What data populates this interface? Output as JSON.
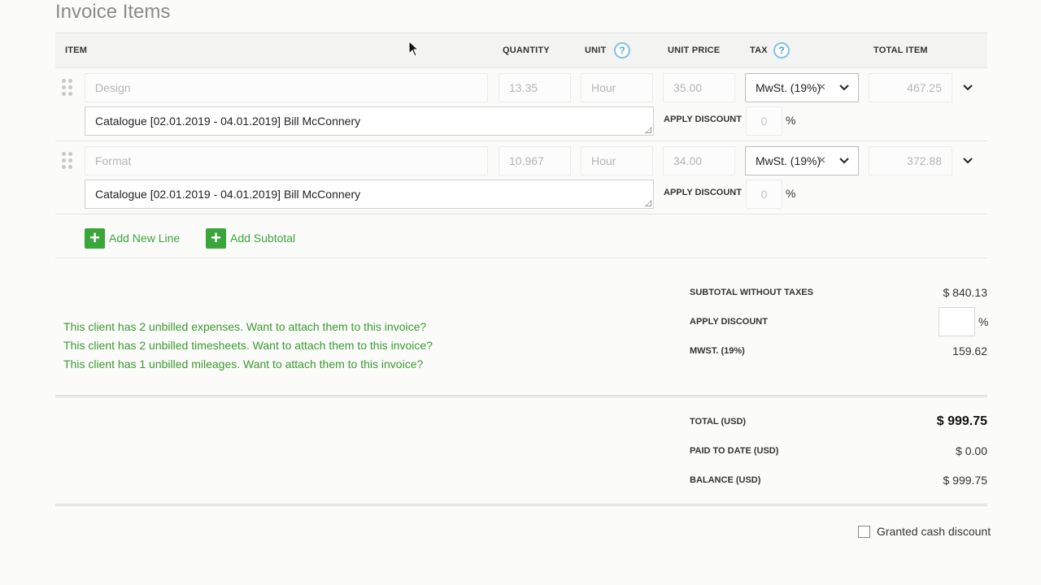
{
  "page": {
    "title": "Invoice Items"
  },
  "table": {
    "headers": {
      "item": "ITEM",
      "quantity": "QUANTITY",
      "unit": "UNIT",
      "unit_price": "UNIT PRICE",
      "tax": "TAX",
      "total_item": "TOTAL ITEM"
    },
    "help_glyph": "?",
    "rows": [
      {
        "item": "Design",
        "quantity": "13.35",
        "unit": "Hour",
        "unit_price": "35.00",
        "tax": "MwSt. (19%)",
        "total": "467.25",
        "description": "Catalogue [02.01.2019 - 04.01.2019] Bill McConnery",
        "apply_discount_label": "APPLY DISCOUNT",
        "discount_value": "0",
        "discount_unit": "%"
      },
      {
        "item": "Format",
        "quantity": "10.967",
        "unit": "Hour",
        "unit_price": "34.00",
        "tax": "MwSt. (19%)",
        "total": "372.88",
        "description": "Catalogue [02.01.2019 - 04.01.2019] Bill McConnery",
        "apply_discount_label": "APPLY DISCOUNT",
        "discount_value": "0",
        "discount_unit": "%"
      }
    ],
    "tax_clear_glyph": "×"
  },
  "actions": {
    "add_new_line": "Add New Line",
    "add_subtotal": "Add Subtotal",
    "plus_glyph": "+"
  },
  "notices": [
    "This client has 2 unbilled expenses. Want to attach them to this invoice?",
    "This client has 2 unbilled timesheets. Want to attach them to this invoice?",
    "This client has 1 unbilled mileages. Want to attach them to this invoice?"
  ],
  "summary": {
    "subtotal_label": "SUBTOTAL WITHOUT TAXES",
    "subtotal_value": "$ 840.13",
    "apply_discount_label": "APPLY DISCOUNT",
    "discount_unit": "%",
    "tax_label": "MWST. (19%)",
    "tax_value": "159.62",
    "total_label": "TOTAL (USD)",
    "total_value": "$ 999.75",
    "paid_label": "PAID TO DATE (USD)",
    "paid_value": "$ 0.00",
    "balance_label": "BALANCE (USD)",
    "balance_value": "$ 999.75"
  },
  "cash_discount": {
    "label": "Granted cash discount",
    "checked": false
  },
  "colors": {
    "accent_green": "#3aa53a",
    "help_blue": "#4ba3d6"
  }
}
